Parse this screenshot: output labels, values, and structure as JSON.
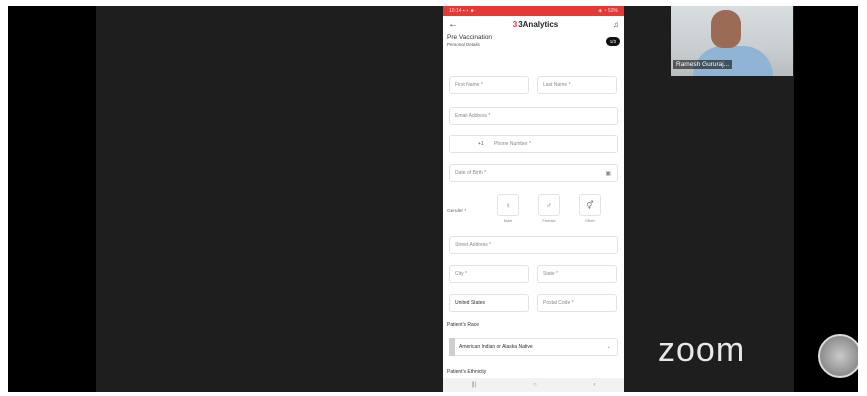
{
  "phone": {
    "status_left": "10:14 ▪ ◐ ■ ·",
    "status_right": "◈ ◔ 53%",
    "app": {
      "back_icon": "arrow-left-icon",
      "logo": "3",
      "brand": "3Analytics",
      "bell_icon": "bell-icon"
    },
    "section": {
      "title": "Pre Vaccination",
      "subtitle": "Personal Details",
      "badge": "1/3"
    },
    "form": {
      "first_name": "First Name *",
      "last_name": "Last Name *",
      "email": "Email Address *",
      "country_code": "+1",
      "phone": "Phone Number *",
      "dob": "Date of Birth *",
      "gender_label": "Gender *",
      "gender_options": [
        "Male",
        "Female",
        "Other"
      ],
      "street": "Street Address *",
      "city": "City *",
      "state": "State *",
      "country": "United States",
      "postal": "Postal Code *",
      "race_label": "Patient's Race",
      "race_value": "American Indian or Alaska Native",
      "ethnicity_label": "Patient's Ethnicity"
    },
    "nav": [
      "|||",
      "○",
      "‹"
    ]
  },
  "camera": {
    "name": "Ramesh Gururaj..."
  },
  "zoom_logo": "zoom"
}
